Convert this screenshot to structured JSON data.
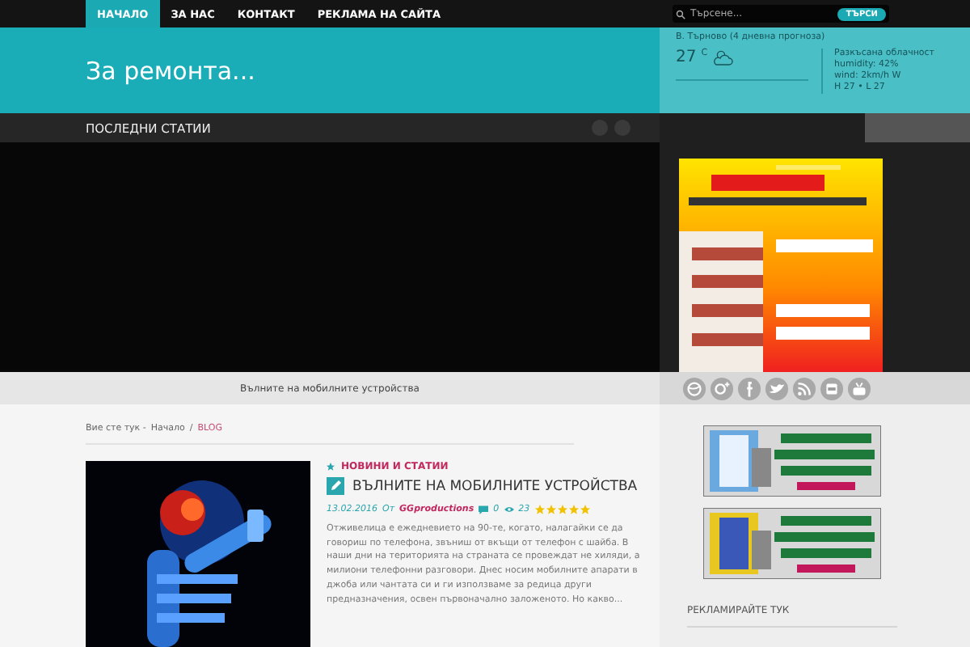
{
  "nav": {
    "items": [
      {
        "label": "НАЧАЛО",
        "selected": true
      },
      {
        "label": "ЗА НАС",
        "selected": false
      },
      {
        "label": "КОНТАКТ",
        "selected": false
      },
      {
        "label": "РЕКЛАМА НА САЙТА",
        "selected": false
      }
    ],
    "search": {
      "placeholder": "Търсене...",
      "button": "ТЪРСИ"
    }
  },
  "header": {
    "site_title": "За ремонта..."
  },
  "weather": {
    "title": "В. Търново (4 дневна прогноза)",
    "temperature": "27",
    "unit": "C",
    "details": [
      "Разкъсана облачност",
      "humidity: 42%",
      "wind: 2km/h W",
      "H 27 • L 27"
    ]
  },
  "slider": {
    "title": "ПОСЛЕДНИ СТАТИИ",
    "caption": "Вълните на мобилните устройства"
  },
  "breadcrumb": {
    "prefix": "Вие сте тук -",
    "home": "Начало",
    "separator": "/",
    "current": "BLOG"
  },
  "article": {
    "category": "НОВИНИ И СТАТИИ",
    "title": "ВЪЛНИТЕ НА МОБИЛНИТЕ УСТРОЙСТВА",
    "date": "13.02.2016",
    "by": "От",
    "author": "GGproductions",
    "comments": "0",
    "views": "23",
    "stars": 5,
    "excerpt": "Отживелица е ежедневието на 90-те, когато, налагайки се да говориш по телефона, звъниш от вкъщи от телефон с шайба. В наши дни на територията на страната се провеждат не хиляди, а милиони телефонни разговори. Днес носим мобилните апарати в джоба или чантата си и ги използваме за редица други предназначения, освен първоначално заложеното. Но какво..."
  },
  "sidebar": {
    "widget_title": "РЕКЛАМИРАЙТЕ ТУК"
  }
}
